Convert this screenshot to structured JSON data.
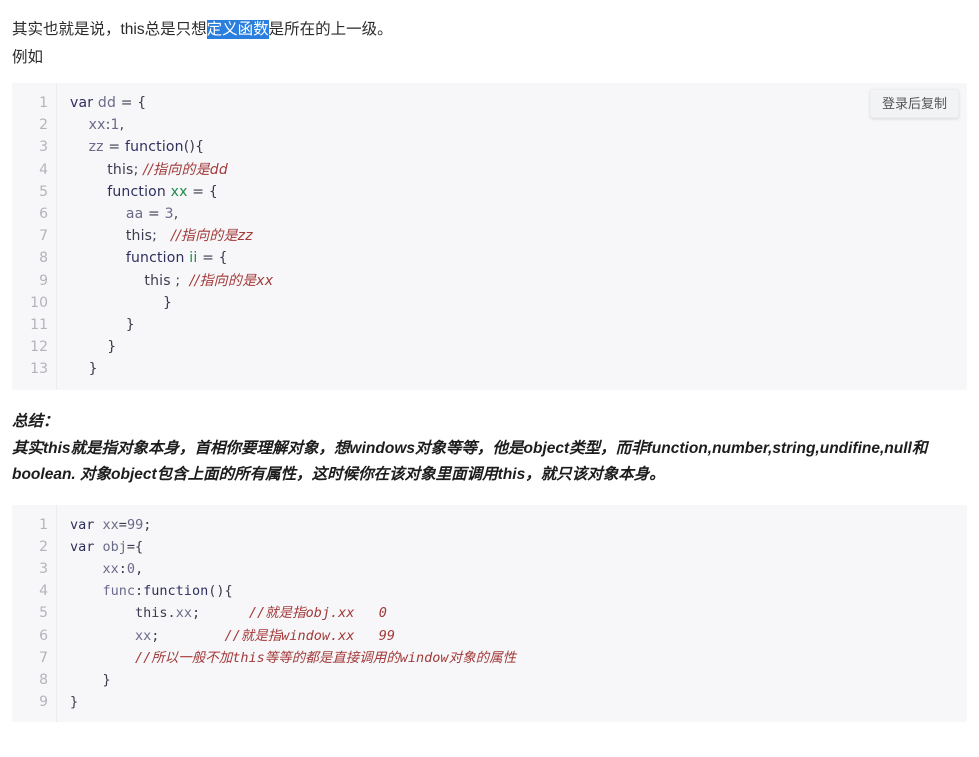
{
  "intro": {
    "line1_before": "其实也就是说，this总是只想",
    "line1_selected": "定义函数",
    "line1_after": "是所在的上一级。",
    "line2": "例如",
    "selection_color": "#2a7fde"
  },
  "code_block_1": {
    "copy_label": "登录后复制",
    "line_numbers": [
      "1",
      "2",
      "3",
      "4",
      "5",
      "6",
      "7",
      "8",
      "9",
      "10",
      "11",
      "12",
      "13"
    ],
    "lines": [
      [
        {
          "t": "var",
          "c": "kw"
        },
        {
          "t": " ",
          "c": "punc"
        },
        {
          "t": "dd",
          "c": "var"
        },
        {
          "t": " = {",
          "c": "punc"
        }
      ],
      [
        {
          "t": "    ",
          "c": "punc"
        },
        {
          "t": "xx",
          "c": "var"
        },
        {
          "t": ":",
          "c": "punc"
        },
        {
          "t": "1",
          "c": "num"
        },
        {
          "t": ",",
          "c": "punc"
        }
      ],
      [
        {
          "t": "    ",
          "c": "punc"
        },
        {
          "t": "zz",
          "c": "var"
        },
        {
          "t": " = ",
          "c": "punc"
        },
        {
          "t": "function",
          "c": "kw"
        },
        {
          "t": "(){",
          "c": "punc"
        }
      ],
      [
        {
          "t": "        ",
          "c": "punc"
        },
        {
          "t": "this",
          "c": "punc"
        },
        {
          "t": "; ",
          "c": "punc"
        },
        {
          "t": "//指向的是dd",
          "c": "cmt"
        }
      ],
      [
        {
          "t": "        ",
          "c": "punc"
        },
        {
          "t": "function",
          "c": "kw"
        },
        {
          "t": " ",
          "c": "punc"
        },
        {
          "t": "xx",
          "c": "id"
        },
        {
          "t": " = {",
          "c": "punc"
        }
      ],
      [
        {
          "t": "            ",
          "c": "punc"
        },
        {
          "t": "aa",
          "c": "var"
        },
        {
          "t": " = ",
          "c": "punc"
        },
        {
          "t": "3",
          "c": "num"
        },
        {
          "t": ",",
          "c": "punc"
        }
      ],
      [
        {
          "t": "            ",
          "c": "punc"
        },
        {
          "t": "this",
          "c": "punc"
        },
        {
          "t": ";   ",
          "c": "punc"
        },
        {
          "t": "//指向的是zz",
          "c": "cmt"
        }
      ],
      [
        {
          "t": "            ",
          "c": "punc"
        },
        {
          "t": "function",
          "c": "kw"
        },
        {
          "t": " ",
          "c": "punc"
        },
        {
          "t": "ii",
          "c": "id"
        },
        {
          "t": " = {",
          "c": "punc"
        }
      ],
      [
        {
          "t": "                ",
          "c": "punc"
        },
        {
          "t": "this",
          "c": "punc"
        },
        {
          "t": " ;  ",
          "c": "punc"
        },
        {
          "t": "//指向的是xx",
          "c": "cmt"
        }
      ],
      [
        {
          "t": "                    }",
          "c": "punc"
        }
      ],
      [
        {
          "t": "            }",
          "c": "punc"
        }
      ],
      [
        {
          "t": "        }",
          "c": "punc"
        }
      ],
      [
        {
          "t": "    }",
          "c": "punc"
        }
      ]
    ]
  },
  "summary": {
    "heading": "总结：",
    "body": "其实this就是指对象本身，首相你要理解对象，想windows对象等等，他是object类型，而非function,number,string,undifine,null和boolean. 对象object包含上面的所有属性，这时候你在该对象里面调用this，就只该对象本身。"
  },
  "code_block_2": {
    "line_numbers": [
      "1",
      "2",
      "3",
      "4",
      "5",
      "6",
      "7",
      "8",
      "9"
    ],
    "lines": [
      [
        {
          "t": "var",
          "c": "kw"
        },
        {
          "t": " ",
          "c": "punc"
        },
        {
          "t": "xx",
          "c": "var"
        },
        {
          "t": "=",
          "c": "punc"
        },
        {
          "t": "99",
          "c": "num"
        },
        {
          "t": ";",
          "c": "punc"
        }
      ],
      [
        {
          "t": "var",
          "c": "kw"
        },
        {
          "t": " ",
          "c": "punc"
        },
        {
          "t": "obj",
          "c": "var"
        },
        {
          "t": "={",
          "c": "punc"
        }
      ],
      [
        {
          "t": "    ",
          "c": "punc"
        },
        {
          "t": "xx",
          "c": "var"
        },
        {
          "t": ":",
          "c": "punc"
        },
        {
          "t": "0",
          "c": "num"
        },
        {
          "t": ",",
          "c": "punc"
        }
      ],
      [
        {
          "t": "    ",
          "c": "punc"
        },
        {
          "t": "func",
          "c": "var"
        },
        {
          "t": ":",
          "c": "punc"
        },
        {
          "t": "function",
          "c": "kw"
        },
        {
          "t": "(){",
          "c": "punc"
        }
      ],
      [
        {
          "t": "        ",
          "c": "punc"
        },
        {
          "t": "this",
          "c": "punc"
        },
        {
          "t": ".",
          "c": "punc"
        },
        {
          "t": "xx",
          "c": "var"
        },
        {
          "t": ";      ",
          "c": "punc"
        },
        {
          "t": "//就是指obj.xx   0",
          "c": "cmt"
        }
      ],
      [
        {
          "t": "        ",
          "c": "punc"
        },
        {
          "t": "xx",
          "c": "var"
        },
        {
          "t": ";        ",
          "c": "punc"
        },
        {
          "t": "//就是指window.xx   99",
          "c": "cmt"
        }
      ],
      [
        {
          "t": "        ",
          "c": "punc"
        },
        {
          "t": "//所以一般不加this等等的都是直接调用的window对象的属性",
          "c": "cmt"
        }
      ],
      [
        {
          "t": "    }",
          "c": "punc"
        }
      ],
      [
        {
          "t": "}",
          "c": "punc"
        }
      ]
    ]
  }
}
